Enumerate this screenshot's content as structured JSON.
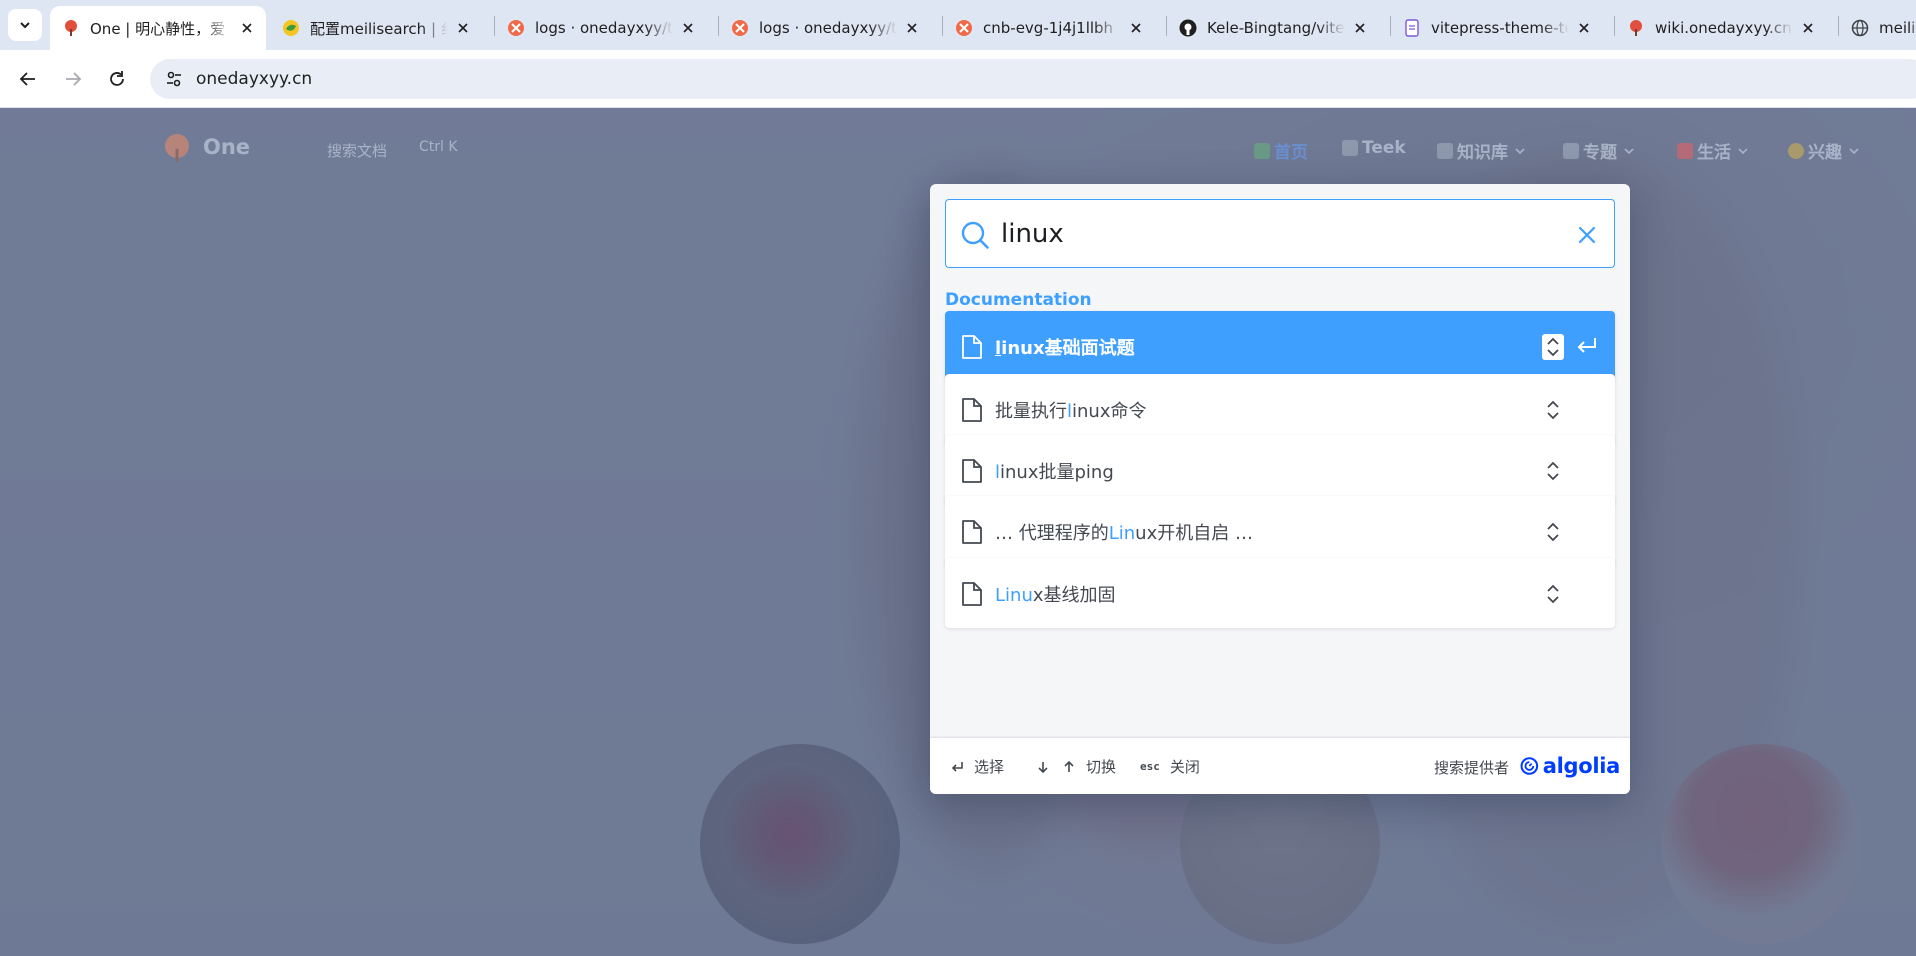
{
  "browser": {
    "tabs": [
      {
        "title": "One | 明心静性，爱"
      },
      {
        "title": "配置meilisearch | 纟"
      },
      {
        "title": "logs · onedayxyy/t"
      },
      {
        "title": "logs · onedayxyy/t"
      },
      {
        "title": "cnb-evg-1j4j1llbh"
      },
      {
        "title": "Kele-Bingtang/vite"
      },
      {
        "title": "vitepress-theme-te"
      },
      {
        "title": "wiki.onedayxyy.cn/"
      },
      {
        "title": "meili"
      }
    ],
    "url": "onedayxyy.cn"
  },
  "site": {
    "title": "One",
    "search_label": "搜索文档",
    "search_shortcut": "Ctrl K",
    "nav": [
      {
        "label": "首页"
      },
      {
        "label": "Teek"
      },
      {
        "label": "知识库"
      },
      {
        "label": "专题"
      },
      {
        "label": "生活"
      },
      {
        "label": "兴趣"
      }
    ]
  },
  "search": {
    "query": "linux",
    "section": "Documentation",
    "hits": [
      {
        "pre": "",
        "match": "l",
        "post": "inux基础面试题"
      },
      {
        "pre": "批量执行",
        "match": "l",
        "post": "inux命令"
      },
      {
        "pre": "",
        "match": "l",
        "post": "inux批量ping"
      },
      {
        "pre": "… 代理程序的",
        "match": "Lin",
        "post": "ux开机自启 …"
      },
      {
        "pre": "",
        "match": "Linu",
        "post": "x基线加固"
      }
    ],
    "footer": {
      "select_label": "选择",
      "navigate_label": "切换",
      "close_key": "esc",
      "close_label": "关闭",
      "provider_label": "搜索提供者",
      "provider_name": "algolia"
    }
  },
  "colors": {
    "accent": "#3e9fff",
    "algolia": "#003dff"
  }
}
